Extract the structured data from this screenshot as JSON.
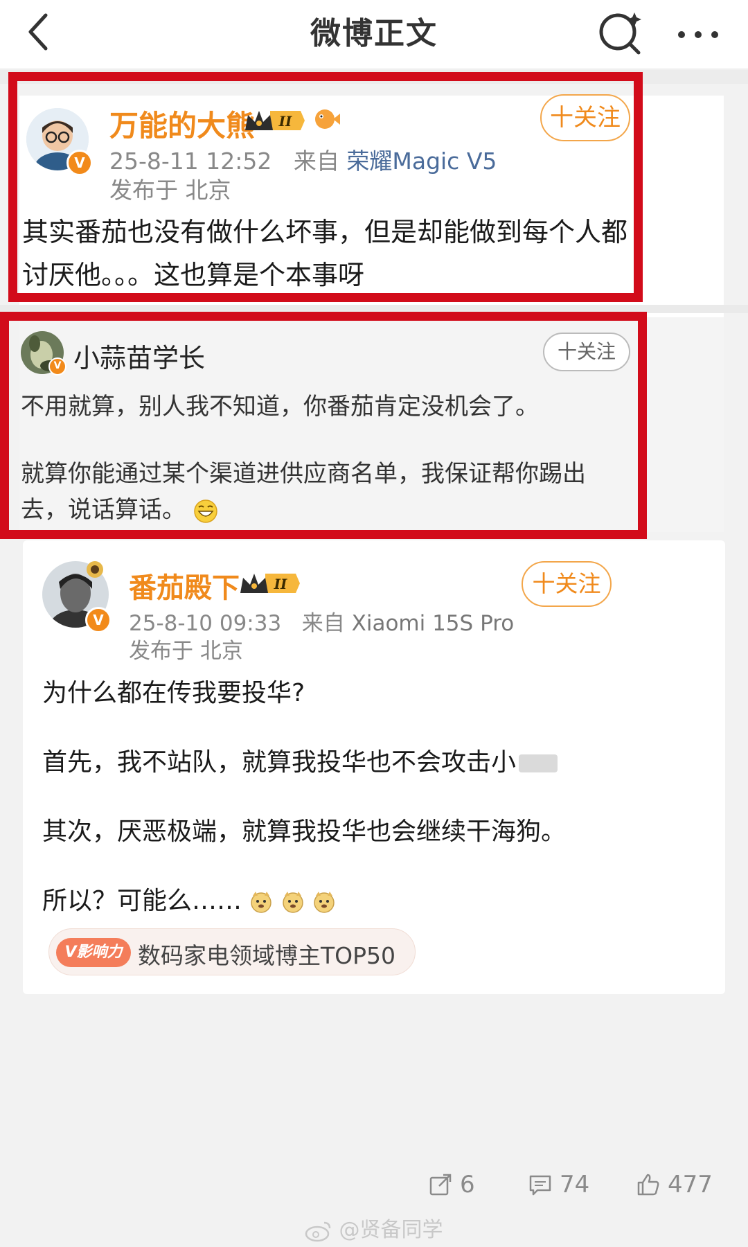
{
  "header": {
    "title": "微博正文"
  },
  "post": {
    "username": "万能的大熊",
    "level": "II",
    "follow_label": "十关注",
    "time": "25-8-11 12:52",
    "source_prefix": "来自",
    "device": "荣耀Magic V5",
    "location": "发布于 北京",
    "text": "其实番茄也没有做什么坏事，但是却能做到每个人都讨厌他。。。这也算是个本事呀"
  },
  "comment": {
    "username": "小蒜苗学长",
    "follow_label": "十关注",
    "line1": "不用就算，别人我不知道，你番茄肯定没机会了。",
    "line2": "就算你能通过某个渠道进供应商名单，我保证帮你踢出去，说话算话。"
  },
  "quoted": {
    "username": "番茄殿下",
    "level": "II",
    "follow_label": "十关注",
    "time": "25-8-10 09:33",
    "source_prefix": "来自",
    "device": "Xiaomi 15S Pro",
    "location": "发布于 北京",
    "p1": "为什么都在传我要投华?",
    "p2": "首先，我不站队，就算我投华也不会攻击小",
    "p3": "其次，厌恶极端，就算我投华也会继续干海狗。",
    "p4": "所以？可能么……",
    "tag_logo": "V影响力",
    "tag_text": "数码家电领域博主TOP50"
  },
  "actions": {
    "repost": "6",
    "comments": "74",
    "likes": "477"
  },
  "watermark": "@贤备同学",
  "colors": {
    "highlight": "#d20b1a",
    "username": "#f08a1c",
    "device": "#4a6b9a",
    "vip": "#f28a1a"
  }
}
